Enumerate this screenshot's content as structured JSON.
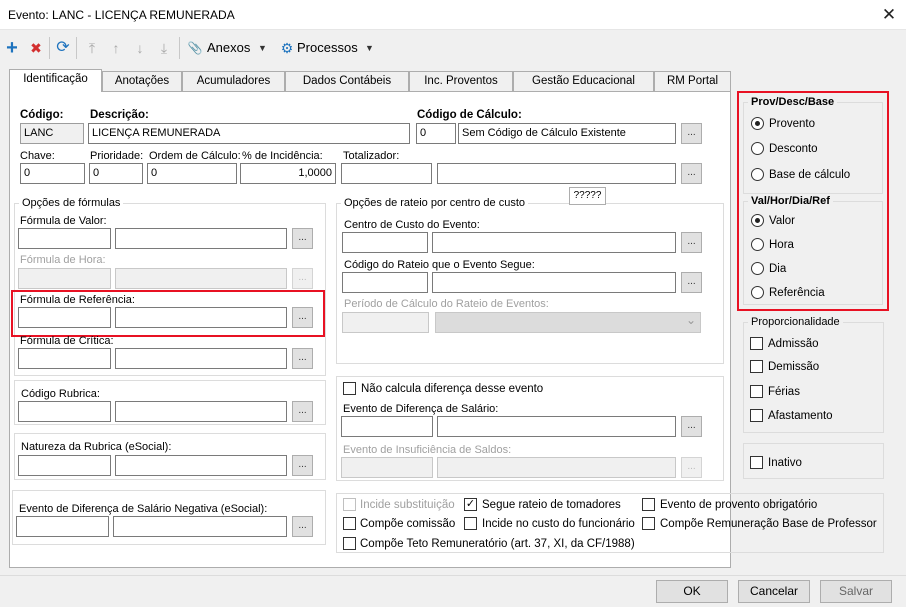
{
  "window": {
    "title": "Evento: LANC - LICENÇA REMUNERADA",
    "close_glyph": "✕"
  },
  "toolbar": {
    "add_glyph": "+",
    "delete_glyph": "✖",
    "refresh_glyph": "⟳",
    "first_glyph": "⤒",
    "prev_glyph": "↑",
    "next_glyph": "↓",
    "last_glyph": "⤓",
    "attach_glyph": "📎",
    "gear_glyph": "⚙",
    "caret": "▼",
    "anexos_label": "Anexos",
    "processos_label": "Processos"
  },
  "tabs": [
    "Identificação",
    "Anotações",
    "Acumuladores",
    "Dados Contábeis",
    "Inc. Proventos",
    "Gestão Educacional",
    "RM Portal"
  ],
  "ident": {
    "codigo_label": "Código:",
    "codigo_value": "LANC",
    "descricao_label": "Descrição:",
    "descricao_value": "LICENÇA REMUNERADA",
    "calc_label": "Código de Cálculo:",
    "calc_code": "0",
    "calc_desc": "Sem Código de Cálculo Existente",
    "chave_label": "Chave:",
    "chave_value": "0",
    "prioridade_label": "Prioridade:",
    "prioridade_value": "0",
    "ordem_label": "Ordem de Cálculo:",
    "ordem_value": "0",
    "incidencia_label": "% de Incidência:",
    "incidencia_value": "1,0000",
    "totalizador_label": "Totalizador:"
  },
  "formulas": {
    "group_title": "Opções de fórmulas",
    "valor_label": "Fórmula de Valor:",
    "hora_label": "Fórmula de Hora:",
    "referencia_label": "Fórmula de Referência:",
    "critica_label": "Fórmula de Crítica:"
  },
  "rateio": {
    "group_title": "Opções de rateio por centro de custo",
    "badge": "?????",
    "centro_label": "Centro de Custo do Evento:",
    "codigo_label": "Código do Rateio que o Evento Segue:",
    "periodo_label": "Período de Cálculo do Rateio de Eventos:"
  },
  "rubrica": {
    "label": "Código Rubrica:"
  },
  "natureza": {
    "label": "Natureza da Rubrica (eSocial):"
  },
  "negativa": {
    "label": "Evento de Diferença de Salário Negativa (eSocial):"
  },
  "diferenca": {
    "nao_calcula_label": "Não calcula diferença desse evento",
    "evento_label": "Evento de Diferença de Salário:",
    "insuficiencia_label": "Evento de Insuficiência de Saldos:"
  },
  "checks": {
    "incide_subst": "Incide substituição",
    "segue_rateio": "Segue rateio de tomadores",
    "evento_obrig": "Evento de provento obrigatório",
    "compoe_comissao": "Compõe comissão",
    "incide_custo": "Incide no custo do funcionário",
    "compoe_base_prof": "Compõe Remuneração Base de Professor",
    "compoe_teto": "Compõe Teto Remuneratório (art. 37, XI, da CF/1988)",
    "check_glyph": "✓"
  },
  "prov": {
    "title": "Prov/Desc/Base",
    "options": [
      "Provento",
      "Desconto",
      "Base de cálculo"
    ],
    "selected": "Provento"
  },
  "valhor": {
    "title": "Val/Hor/Dia/Ref",
    "options": [
      "Valor",
      "Hora",
      "Dia",
      "Referência"
    ],
    "selected": "Valor"
  },
  "proporcionalidade": {
    "title": "Proporcionalidade",
    "options": [
      "Admissão",
      "Demissão",
      "Férias",
      "Afastamento"
    ]
  },
  "inativo": {
    "label": "Inativo"
  },
  "buttons": {
    "ok": "OK",
    "cancelar": "Cancelar",
    "salvar": "Salvar",
    "ellipsis": "...",
    "dropdown": "⌄"
  },
  "colors": {
    "highlight": "#e81123",
    "add": "#1e73be",
    "delete": "#d32f2f"
  }
}
